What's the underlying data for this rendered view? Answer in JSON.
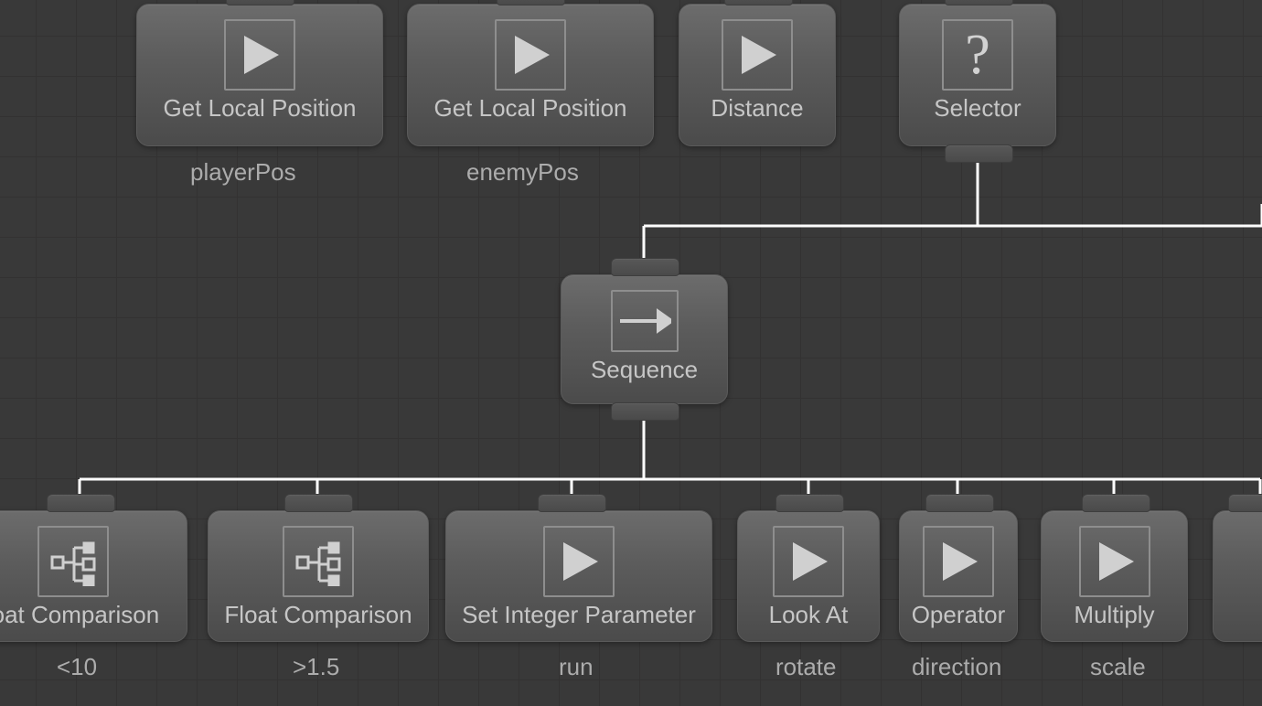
{
  "nodes": {
    "getLocalPos1": {
      "label": "Get Local Position",
      "subtitle": "playerPos"
    },
    "getLocalPos2": {
      "label": "Get Local Position",
      "subtitle": "enemyPos"
    },
    "distance": {
      "label": "Distance"
    },
    "selector": {
      "label": "Selector"
    },
    "sequence": {
      "label": "Sequence"
    },
    "floatCompA": {
      "label": "loat Comparison",
      "subtitle": "<10"
    },
    "floatCompB": {
      "label": "Float Comparison",
      "subtitle": ">1.5"
    },
    "setInt": {
      "label": "Set Integer Parameter",
      "subtitle": "run"
    },
    "lookAt": {
      "label": "Look At",
      "subtitle": "rotate"
    },
    "operator": {
      "label": "Operator",
      "subtitle": "direction"
    },
    "multiply": {
      "label": "Multiply",
      "subtitle": "scale"
    }
  }
}
